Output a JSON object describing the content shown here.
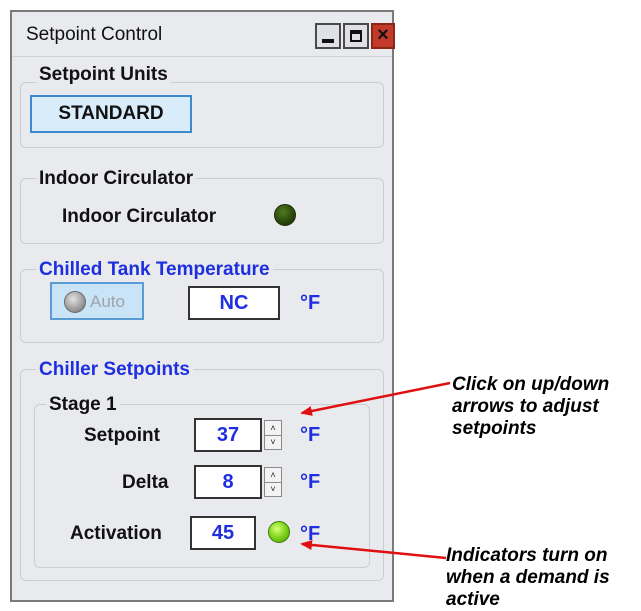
{
  "window": {
    "title": "Setpoint Control",
    "close_symbol": "×"
  },
  "setpoint_units": {
    "group_title": "Setpoint Units",
    "button_label": "STANDARD"
  },
  "indoor_circulator": {
    "group_title": "Indoor Circulator",
    "label": "Indoor Circulator",
    "indicator_state": "off"
  },
  "chilled_tank": {
    "group_title": "Chilled Tank Temperature",
    "auto_label": "Auto",
    "value": "NC",
    "unit": "°F"
  },
  "chiller_setpoints": {
    "group_title": "Chiller Setpoints",
    "stage_title": "Stage 1",
    "setpoint": {
      "label": "Setpoint",
      "value": "37",
      "unit": "°F"
    },
    "delta": {
      "label": "Delta",
      "value": "8",
      "unit": "°F"
    },
    "activation": {
      "label": "Activation",
      "value": "45",
      "unit": "°F",
      "indicator_state": "on"
    },
    "spin_up": "˄",
    "spin_down": "˅"
  },
  "annotations": {
    "arrows_note": "Click on up/down\narrows to adjust\nsetpoints",
    "indicators_note": "Indicators turn on\nwhen a demand is\nactive",
    "arrow_color": "#e01010"
  },
  "colors": {
    "accent_blue": "#1f2fe0",
    "close_red": "#c43a2a",
    "indicator_on": "#7dd31a",
    "indicator_off": "#2c4a0c"
  }
}
